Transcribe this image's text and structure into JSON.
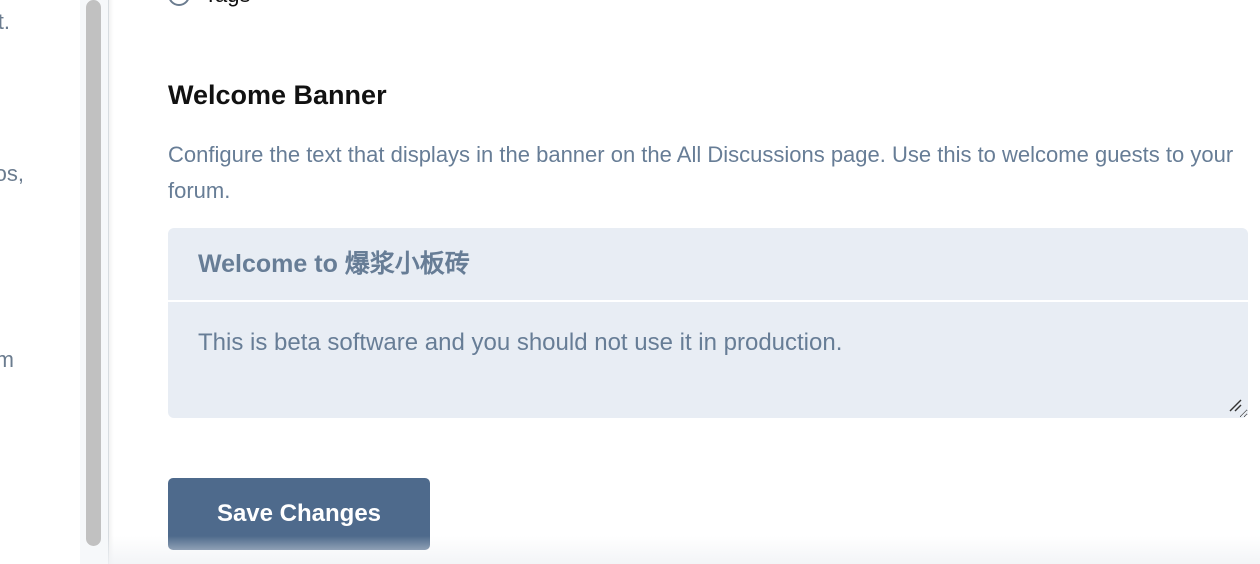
{
  "sidebar": {
    "fragments": [
      "t.",
      "os,",
      "m"
    ]
  },
  "radio_option": {
    "label": "Tags"
  },
  "welcome_banner": {
    "title": "Welcome Banner",
    "description": "Configure the text that displays in the banner on the All Discussions page. Use this to welcome guests to your forum.",
    "banner_title_value": "Welcome to 爆浆小板砖",
    "banner_text_value": "This is beta software and you should not use it in production."
  },
  "actions": {
    "save_label": "Save Changes"
  },
  "colors": {
    "primary_button": "#4e6a8c",
    "muted_text": "#677d96",
    "input_background": "#e8edf4"
  }
}
